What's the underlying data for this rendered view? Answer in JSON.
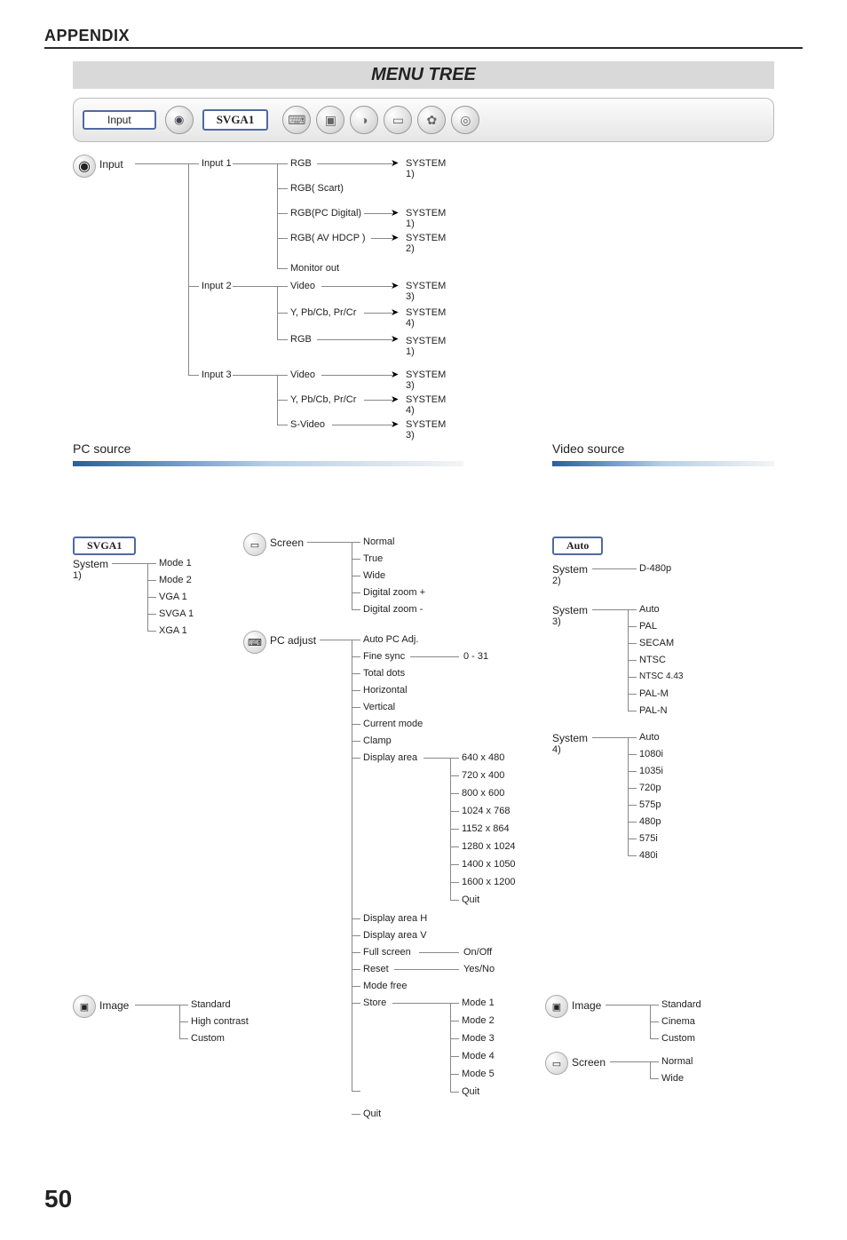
{
  "header": {
    "appendix": "APPENDIX",
    "title": "MENU TREE",
    "page": "50"
  },
  "capsule": {
    "input": "Input",
    "badge": "SVGA1"
  },
  "tree": {
    "input_root": "Input",
    "input1": "Input 1",
    "input2": "Input 2",
    "input3": "Input 3",
    "i1a": "RGB",
    "i1b": "RGB( Scart)",
    "i1c": "RGB(PC Digital)",
    "i1d": "RGB( AV HDCP )",
    "i1e": "Monitor out",
    "i2a": "Video",
    "i2b": "Y, Pb/Cb, Pr/Cr",
    "i2c": "RGB",
    "i3a": "Video",
    "i3b": "Y, Pb/Cb, Pr/Cr",
    "i3c": "S-Video",
    "s1": "SYSTEM",
    "s1n": "1)",
    "s2n": "2)",
    "s3n": "3)",
    "s4n": "4)",
    "pc_source": "PC source",
    "video_source": "Video source",
    "svga_badge": "SVGA1",
    "auto_badge": "Auto",
    "system": "System",
    "m1": "Mode 1",
    "m2": "Mode 2",
    "m3": "VGA 1",
    "m4": "SVGA 1",
    "m5": "XGA 1",
    "screen": "Screen",
    "sc1": "Normal",
    "sc2": "True",
    "sc3": "Wide",
    "sc4": "Digital zoom +",
    "sc5": "Digital zoom -",
    "pcadj": "PC adjust",
    "p1": "Auto PC Adj.",
    "p2": "Fine sync",
    "p2r": "0 - 31",
    "p3": "Total dots",
    "p4": "Horizontal",
    "p5": "Vertical",
    "p6": "Current mode",
    "p7": "Clamp",
    "p8": "Display area",
    "d1": "640 x 480",
    "d2": "720 x 400",
    "d3": "800 x 600",
    "d4": "1024 x 768",
    "d5": "1152 x 864",
    "d6": "1280 x 1024",
    "d7": "1400 x 1050",
    "d8": "1600 x 1200",
    "d9": "Quit",
    "p9": "Display area H",
    "p10": "Display area V",
    "p11": "Full screen",
    "p11r": "On/Off",
    "p12": "Reset",
    "p12r": "Yes/No",
    "p13": "Mode free",
    "p14": "Store",
    "p15": "Quit",
    "st1": "Mode 1",
    "st2": "Mode 2",
    "st3": "Mode 3",
    "st4": "Mode 4",
    "st5": "Mode 5",
    "st6": "Quit",
    "vs2": "D-480p",
    "v3a": "Auto",
    "v3b": "PAL",
    "v3c": "SECAM",
    "v3d": "NTSC",
    "v3e": "NTSC 4.43",
    "v3f": "PAL-M",
    "v3g": "PAL-N",
    "v4a": "Auto",
    "v4b": "1080i",
    "v4c": "1035i",
    "v4d": "720p",
    "v4e": "575p",
    "v4f": "480p",
    "v4g": "575i",
    "v4h": "480i",
    "image": "Image",
    "img1": "Standard",
    "img2": "High contrast",
    "img3": "Custom",
    "vimg1": "Standard",
    "vimg2": "Cinema",
    "vimg3": "Custom",
    "vscr1": "Normal",
    "vscr2": "Wide"
  }
}
